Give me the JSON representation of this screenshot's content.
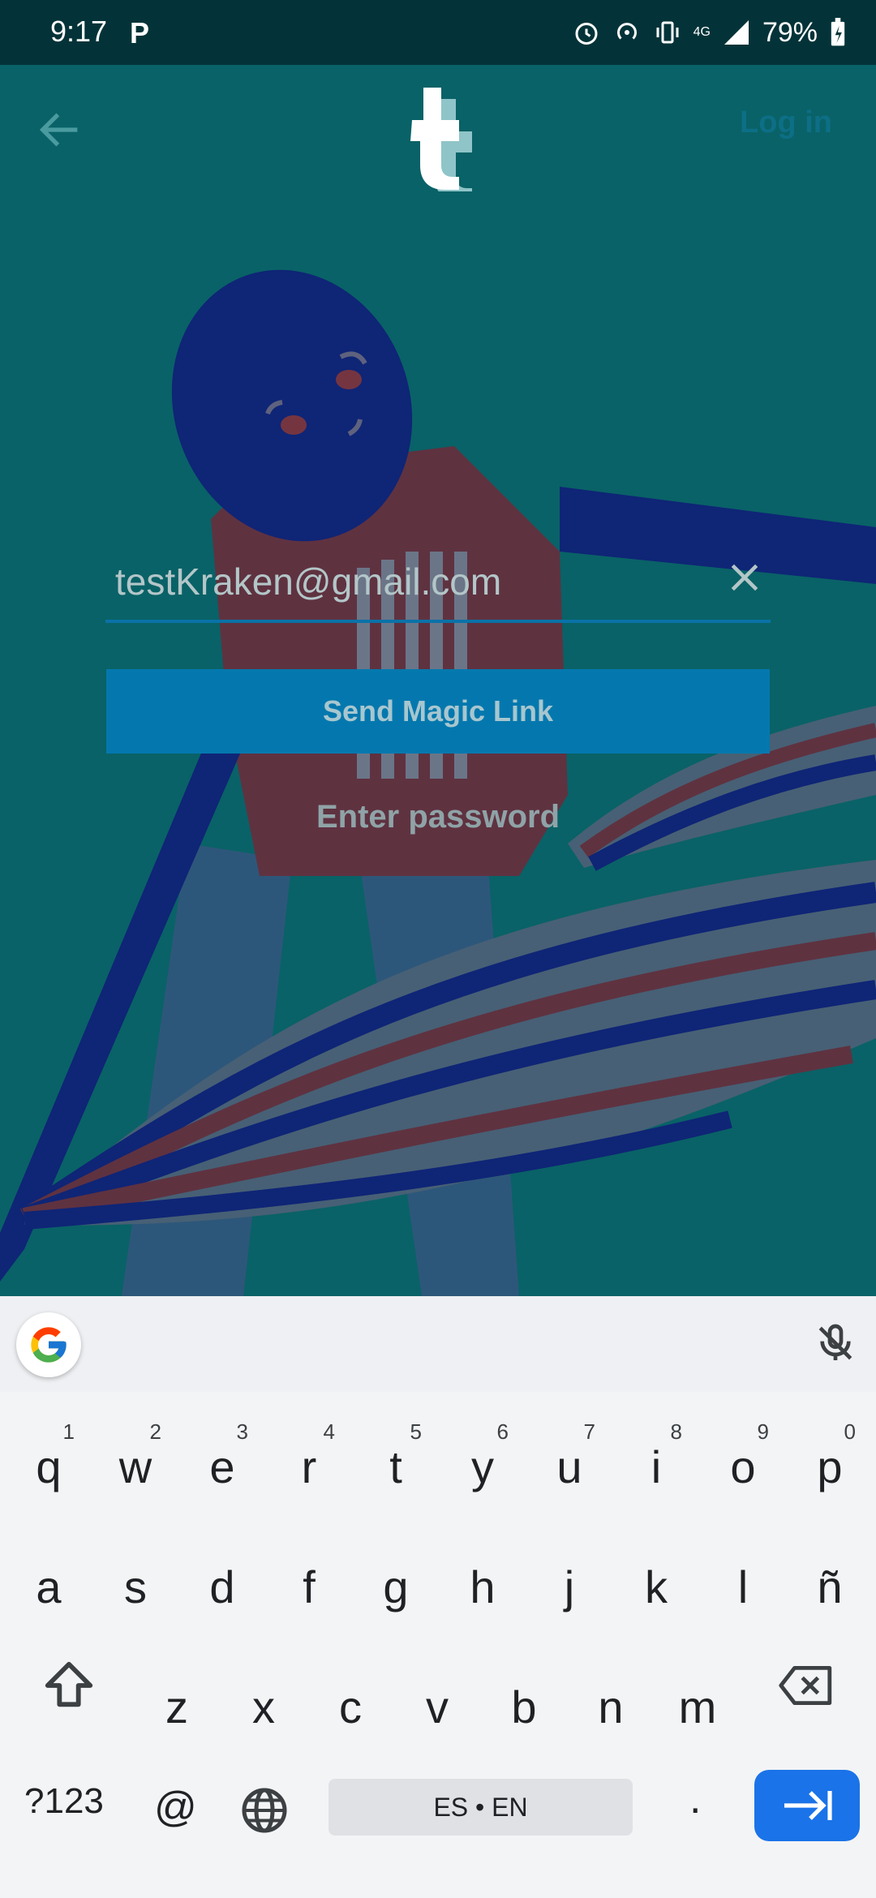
{
  "status_bar": {
    "time": "9:17",
    "battery": "79%",
    "network": "4G"
  },
  "header": {
    "login_label": "Log in"
  },
  "form": {
    "email_value": "testKraken@gmail.com",
    "send_magic_link_label": "Send Magic Link",
    "enter_password_label": "Enter password"
  },
  "keyboard": {
    "row1": [
      {
        "key": "q",
        "num": "1"
      },
      {
        "key": "w",
        "num": "2"
      },
      {
        "key": "e",
        "num": "3"
      },
      {
        "key": "r",
        "num": "4"
      },
      {
        "key": "t",
        "num": "5"
      },
      {
        "key": "y",
        "num": "6"
      },
      {
        "key": "u",
        "num": "7"
      },
      {
        "key": "i",
        "num": "8"
      },
      {
        "key": "o",
        "num": "9"
      },
      {
        "key": "p",
        "num": "0"
      }
    ],
    "row2": [
      "a",
      "s",
      "d",
      "f",
      "g",
      "h",
      "j",
      "k",
      "l",
      "ñ"
    ],
    "row3": [
      "z",
      "x",
      "c",
      "v",
      "b",
      "n",
      "m"
    ],
    "symbols_label": "?123",
    "at_label": "@",
    "space_label": "ES • EN",
    "period_label": "."
  },
  "colors": {
    "accent": "#0478ae",
    "background": "#0a6b70",
    "enter_key": "#1a73e8"
  }
}
